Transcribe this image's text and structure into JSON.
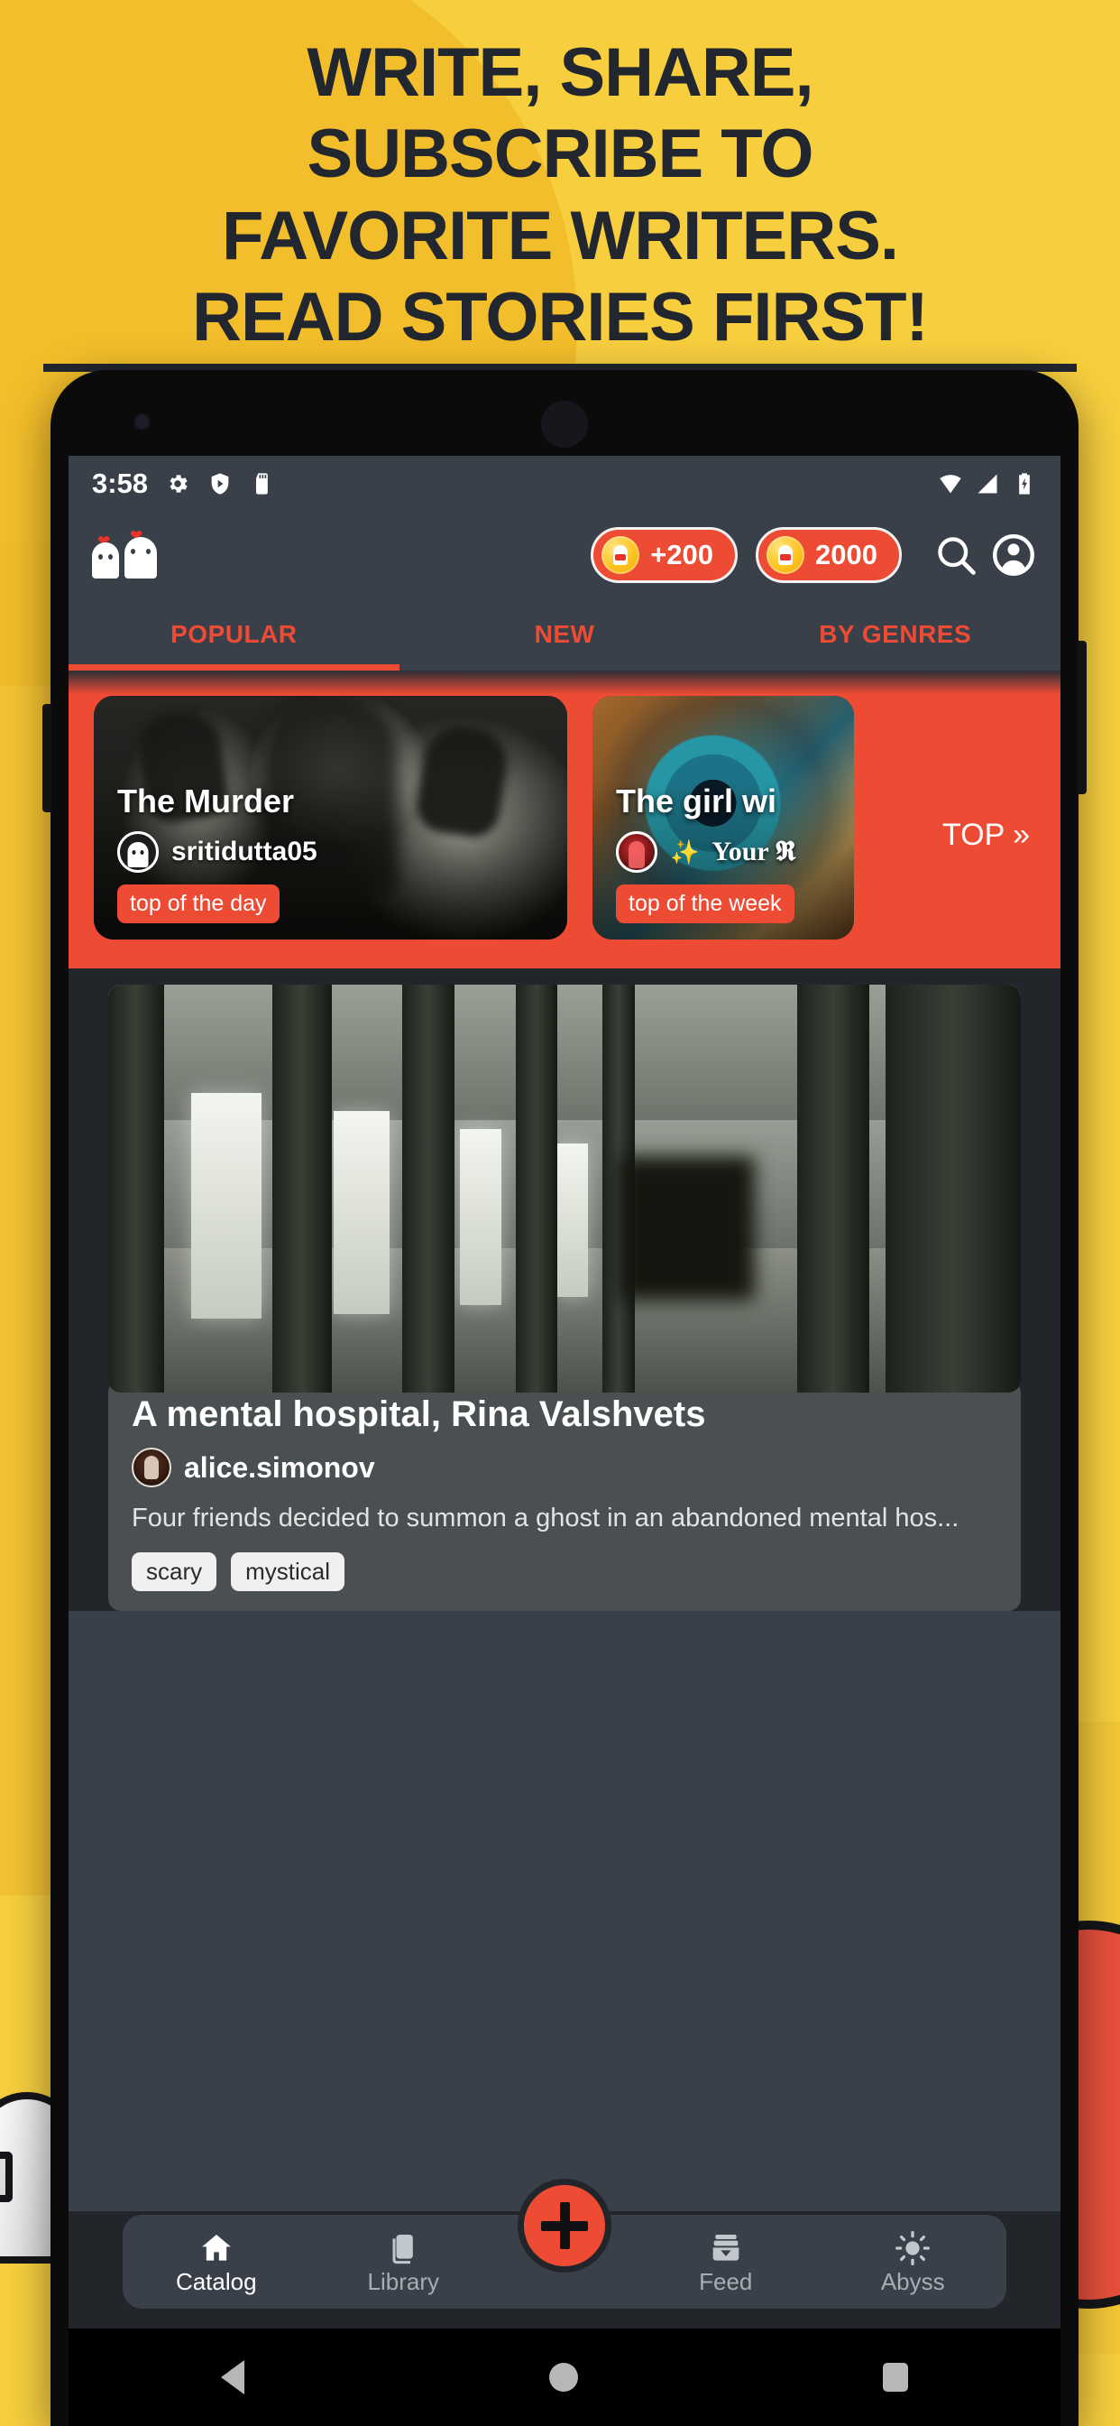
{
  "promo": {
    "headline_lines": [
      "WRITE, SHARE,",
      "SUBSCRIBE TO",
      "FAVORITE WRITERS.",
      "READ STORIES FIRST!"
    ],
    "background_color": "#F7CF3E",
    "text_color": "#22262E"
  },
  "statusbar": {
    "time": "3:58",
    "left_icons": [
      "gear-icon",
      "shield-play-icon",
      "sd-card-icon"
    ],
    "right_icons": [
      "wifi-icon",
      "signal-icon",
      "battery-charging-icon"
    ]
  },
  "appheader": {
    "brand_icon": "ghost-couple-icon",
    "chips": [
      {
        "icon": "coin-icon",
        "label": "+200"
      },
      {
        "icon": "coin-icon",
        "label": "2000"
      }
    ],
    "search_icon": "search-icon",
    "profile_icon": "account-icon",
    "accent_color": "#EE4B35",
    "bar_color": "#3A4049"
  },
  "tabs": {
    "items": [
      {
        "label": "POPULAR",
        "active": true
      },
      {
        "label": "NEW",
        "active": false
      },
      {
        "label": "BY GENRES",
        "active": false
      }
    ]
  },
  "carousel": {
    "background_color": "#EE4B35",
    "top_link": "TOP »",
    "cards": [
      {
        "title": "The Murder",
        "author": "sritidutta05",
        "badge": "top of the day",
        "avatar": "ghost-avatar"
      },
      {
        "title": "The girl wi",
        "author_prefix": "✨",
        "author": "Your 𝕽",
        "badge": "top of the week",
        "avatar": "red-figure-avatar"
      }
    ]
  },
  "story": {
    "title": "A mental hospital, Rina Valshvets",
    "author": "alice.simonov",
    "description": "Four friends decided to summon a ghost in an abandoned mental hos...",
    "tags": [
      "scary",
      "mystical"
    ],
    "image_alt": "abandoned-hospital-corridor"
  },
  "bottomnav": {
    "items": [
      {
        "label": "Catalog",
        "icon": "home-icon",
        "active": true
      },
      {
        "label": "Library",
        "icon": "book-icon",
        "active": false
      },
      {
        "label": "Feed",
        "icon": "inbox-icon",
        "active": false
      },
      {
        "label": "Abyss",
        "icon": "sun-icon",
        "active": false
      }
    ],
    "fab_icon": "plus-icon",
    "fab_color": "#EE4B35"
  },
  "androidnav": {
    "back": "back-icon",
    "home": "home-circle-icon",
    "recents": "recents-icon"
  }
}
